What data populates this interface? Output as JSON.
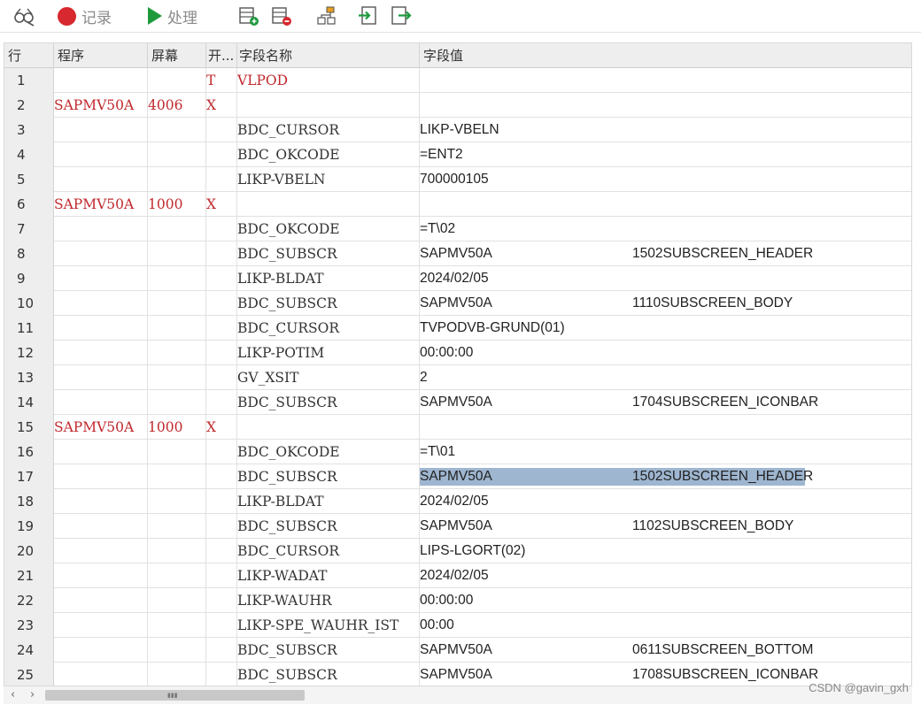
{
  "toolbar": {
    "record_label": "记录",
    "process_label": "处理",
    "icons": [
      "glasses-icon",
      "record-icon",
      "play-icon",
      "insert-row-icon",
      "delete-row-icon",
      "org-chart-icon",
      "import-icon",
      "export-icon"
    ]
  },
  "columns": [
    "行",
    "程序",
    "屏幕",
    "开...",
    "字段名称",
    "字段值"
  ],
  "rows": [
    {
      "num": "1",
      "program": "",
      "screen": "",
      "open": "T",
      "fname": "VLPOD",
      "fval": "",
      "fval2": ""
    },
    {
      "num": "2",
      "program": "SAPMV50A",
      "screen": "4006",
      "open": "X",
      "fname": "",
      "fval": "",
      "fval2": ""
    },
    {
      "num": "3",
      "program": "",
      "screen": "",
      "open": "",
      "fname": "BDC_CURSOR",
      "fval": "LIKP-VBELN",
      "fval2": ""
    },
    {
      "num": "4",
      "program": "",
      "screen": "",
      "open": "",
      "fname": "BDC_OKCODE",
      "fval": "=ENT2",
      "fval2": ""
    },
    {
      "num": "5",
      "program": "",
      "screen": "",
      "open": "",
      "fname": "LIKP-VBELN",
      "fval": "700000105",
      "fval2": ""
    },
    {
      "num": "6",
      "program": "SAPMV50A",
      "screen": "1000",
      "open": "X",
      "fname": "",
      "fval": "",
      "fval2": ""
    },
    {
      "num": "7",
      "program": "",
      "screen": "",
      "open": "",
      "fname": "BDC_OKCODE",
      "fval": "=T\\02",
      "fval2": ""
    },
    {
      "num": "8",
      "program": "",
      "screen": "",
      "open": "",
      "fname": "BDC_SUBSCR",
      "fval": "SAPMV50A",
      "fval2": "1502SUBSCREEN_HEADER"
    },
    {
      "num": "9",
      "program": "",
      "screen": "",
      "open": "",
      "fname": "LIKP-BLDAT",
      "fval": "2024/02/05",
      "fval2": ""
    },
    {
      "num": "10",
      "program": "",
      "screen": "",
      "open": "",
      "fname": "BDC_SUBSCR",
      "fval": "SAPMV50A",
      "fval2": "1110SUBSCREEN_BODY"
    },
    {
      "num": "11",
      "program": "",
      "screen": "",
      "open": "",
      "fname": "BDC_CURSOR",
      "fval": "TVPODVB-GRUND(01)",
      "fval2": ""
    },
    {
      "num": "12",
      "program": "",
      "screen": "",
      "open": "",
      "fname": "LIKP-POTIM",
      "fval": "00:00:00",
      "fval2": ""
    },
    {
      "num": "13",
      "program": "",
      "screen": "",
      "open": "",
      "fname": "GV_XSIT",
      "fval": "2",
      "fval2": ""
    },
    {
      "num": "14",
      "program": "",
      "screen": "",
      "open": "",
      "fname": "BDC_SUBSCR",
      "fval": "SAPMV50A",
      "fval2": "1704SUBSCREEN_ICONBAR"
    },
    {
      "num": "15",
      "program": "SAPMV50A",
      "screen": "1000",
      "open": "X",
      "fname": "",
      "fval": "",
      "fval2": ""
    },
    {
      "num": "16",
      "program": "",
      "screen": "",
      "open": "",
      "fname": "BDC_OKCODE",
      "fval": "=T\\01",
      "fval2": ""
    },
    {
      "num": "17",
      "program": "",
      "screen": "",
      "open": "",
      "fname": "BDC_SUBSCR",
      "fval": "SAPMV50A",
      "fval2": "1502SUBSCREEN_HEADER",
      "selected": true
    },
    {
      "num": "18",
      "program": "",
      "screen": "",
      "open": "",
      "fname": "LIKP-BLDAT",
      "fval": "2024/02/05",
      "fval2": ""
    },
    {
      "num": "19",
      "program": "",
      "screen": "",
      "open": "",
      "fname": "BDC_SUBSCR",
      "fval": "SAPMV50A",
      "fval2": "1102SUBSCREEN_BODY"
    },
    {
      "num": "20",
      "program": "",
      "screen": "",
      "open": "",
      "fname": "BDC_CURSOR",
      "fval": "LIPS-LGORT(02)",
      "fval2": ""
    },
    {
      "num": "21",
      "program": "",
      "screen": "",
      "open": "",
      "fname": "LIKP-WADAT",
      "fval": "2024/02/05",
      "fval2": ""
    },
    {
      "num": "22",
      "program": "",
      "screen": "",
      "open": "",
      "fname": "LIKP-WAUHR",
      "fval": "00:00:00",
      "fval2": ""
    },
    {
      "num": "23",
      "program": "",
      "screen": "",
      "open": "",
      "fname": "LIKP-SPE_WAUHR_IST",
      "fval": "00:00",
      "fval2": ""
    },
    {
      "num": "24",
      "program": "",
      "screen": "",
      "open": "",
      "fname": "BDC_SUBSCR",
      "fval": "SAPMV50A",
      "fval2": "0611SUBSCREEN_BOTTOM"
    },
    {
      "num": "25",
      "program": "",
      "screen": "",
      "open": "",
      "fname": "BDC_SUBSCR",
      "fval": "SAPMV50A",
      "fval2": "1708SUBSCREEN_ICONBAR"
    }
  ],
  "scrollbar": {
    "left_arrow": "‹",
    "right_arrow": "›",
    "grip": "▮▮▮"
  },
  "watermark": "CSDN @gavin_gxh",
  "colors": {
    "program_text": "#c0282d",
    "selection": "#9eb6d0",
    "record": "#d6282e",
    "play": "#1e9a3c"
  }
}
